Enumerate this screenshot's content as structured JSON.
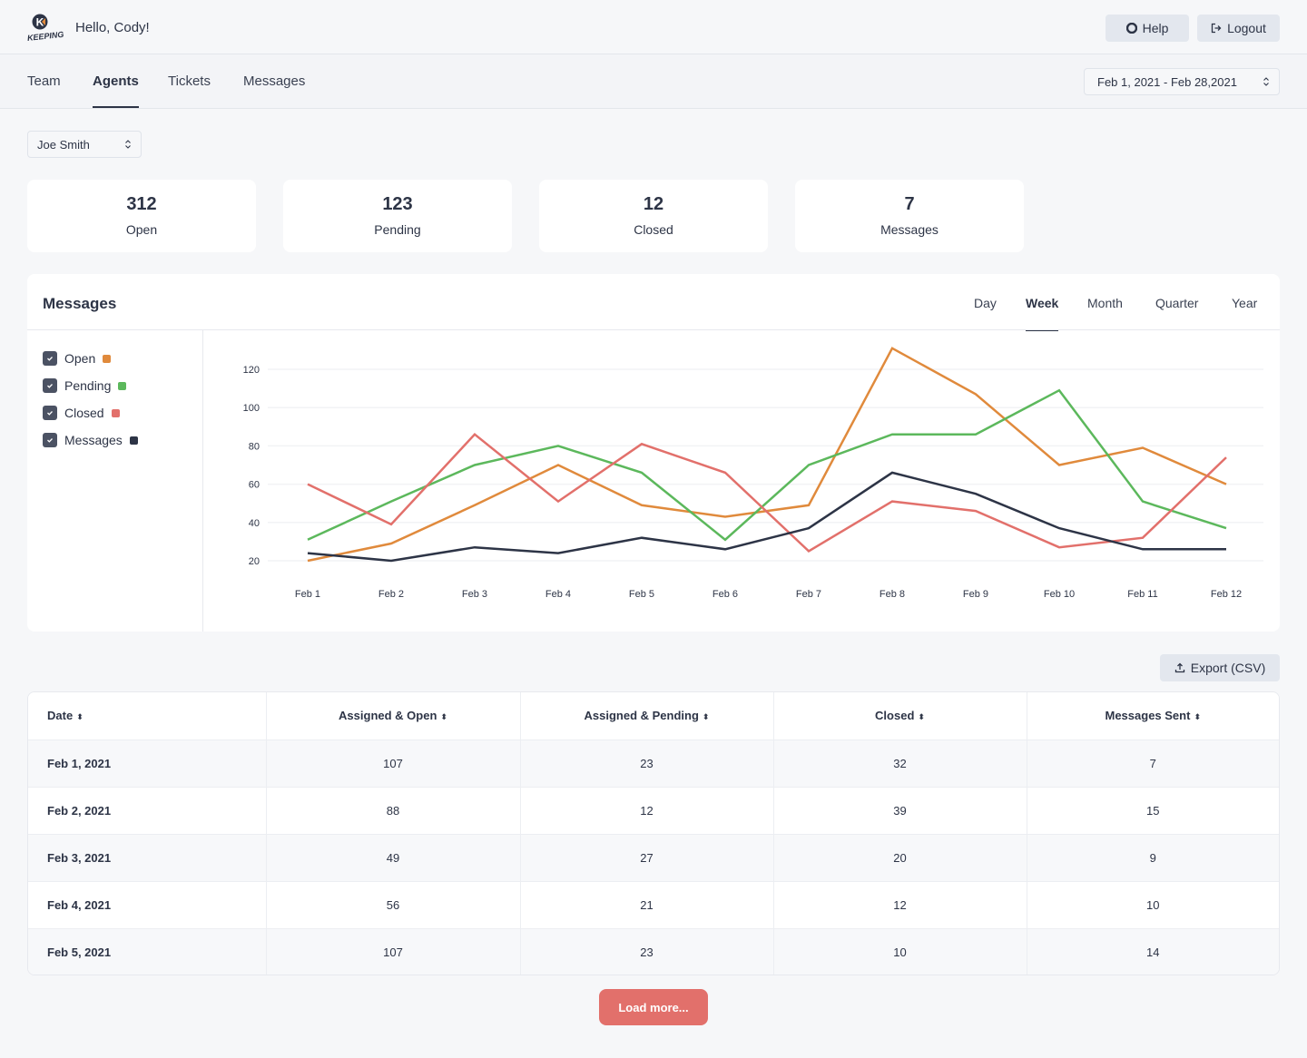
{
  "header": {
    "logo_text": "KEEPING",
    "logo_letter": "K",
    "greeting": "Hello, Cody!",
    "help_label": "Help",
    "logout_label": "Logout"
  },
  "nav": {
    "tabs": [
      {
        "label": "Team",
        "active": false
      },
      {
        "label": "Agents",
        "active": true
      },
      {
        "label": "Tickets",
        "active": false
      },
      {
        "label": "Messages",
        "active": false
      }
    ],
    "date_range": "Feb 1, 2021 - Feb 28,2021"
  },
  "agent_select": {
    "value": "Joe Smith"
  },
  "stats": [
    {
      "value": "312",
      "label": "Open"
    },
    {
      "value": "123",
      "label": "Pending"
    },
    {
      "value": "12",
      "label": "Closed"
    },
    {
      "value": "7",
      "label": "Messages"
    }
  ],
  "chart_card": {
    "title": "Messages",
    "periods": [
      {
        "label": "Day",
        "active": false
      },
      {
        "label": "Week",
        "active": true
      },
      {
        "label": "Month",
        "active": false
      },
      {
        "label": "Quarter",
        "active": false
      },
      {
        "label": "Year",
        "active": false
      }
    ],
    "legend": [
      {
        "label": "Open",
        "checked": true,
        "color": "#e08a3c"
      },
      {
        "label": "Pending",
        "checked": true,
        "color": "#5cb85c"
      },
      {
        "label": "Closed",
        "checked": true,
        "color": "#e2706b"
      },
      {
        "label": "Messages",
        "checked": true,
        "color": "#2d3446"
      }
    ]
  },
  "chart_data": {
    "type": "line",
    "title": "Messages",
    "xlabel": "",
    "ylabel": "",
    "x": [
      "Feb 1",
      "Feb 2",
      "Feb 3",
      "Feb 4",
      "Feb 5",
      "Feb 6",
      "Feb 7",
      "Feb 8",
      "Feb 9",
      "Feb 10",
      "Feb 11",
      "Feb 12"
    ],
    "yticks": [
      20,
      40,
      60,
      80,
      100,
      120
    ],
    "ylim": [
      10,
      130
    ],
    "grid": true,
    "legend_position": "left",
    "series": [
      {
        "name": "Open",
        "color": "#e08a3c",
        "values": [
          20,
          29,
          49,
          70,
          49,
          43,
          49,
          131,
          107,
          70,
          79,
          60
        ]
      },
      {
        "name": "Pending",
        "color": "#5cb85c",
        "values": [
          31,
          51,
          70,
          80,
          66,
          31,
          70,
          86,
          86,
          109,
          51,
          37
        ]
      },
      {
        "name": "Closed",
        "color": "#e2706b",
        "values": [
          60,
          39,
          86,
          51,
          81,
          66,
          25,
          51,
          46,
          27,
          32,
          74
        ]
      },
      {
        "name": "Messages",
        "color": "#2d3446",
        "values": [
          24,
          20,
          27,
          24,
          32,
          26,
          37,
          66,
          55,
          37,
          26,
          26
        ]
      }
    ]
  },
  "export_label": "Export (CSV)",
  "table": {
    "columns": [
      "Date",
      "Assigned & Open",
      "Assigned & Pending",
      "Closed",
      "Messages Sent"
    ],
    "rows": [
      [
        "Feb 1, 2021",
        "107",
        "23",
        "32",
        "7"
      ],
      [
        "Feb 2, 2021",
        "88",
        "12",
        "39",
        "15"
      ],
      [
        "Feb 3, 2021",
        "49",
        "27",
        "20",
        "9"
      ],
      [
        "Feb 4, 2021",
        "56",
        "21",
        "12",
        "10"
      ],
      [
        "Feb 5, 2021",
        "107",
        "23",
        "10",
        "14"
      ]
    ]
  },
  "load_more_label": "Load more..."
}
